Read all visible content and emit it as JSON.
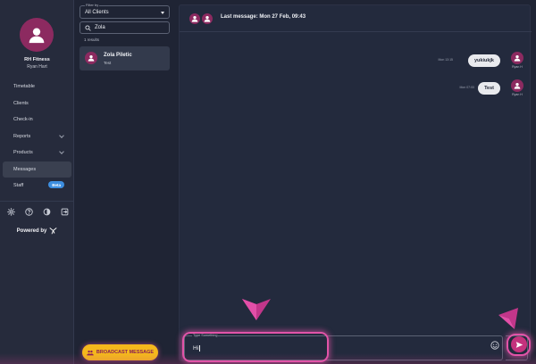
{
  "brand": {
    "name": "RH Fitness",
    "user": "Ryan Hart"
  },
  "nav": {
    "items": [
      {
        "label": "Timetable"
      },
      {
        "label": "Clients"
      },
      {
        "label": "Check-in"
      },
      {
        "label": "Reports"
      },
      {
        "label": "Products"
      },
      {
        "label": "Messages"
      },
      {
        "label": "Staff",
        "badge": "Beta"
      }
    ],
    "powered_by": "Powered by"
  },
  "clients": {
    "filter_label": "Filter by",
    "filter_value": "All Clients",
    "search_value": "Zola",
    "results": "1 results",
    "list": [
      {
        "name": "Zola Piletic",
        "preview": "Test"
      }
    ],
    "broadcast_label": "BROADCAST MESSAGE"
  },
  "chat": {
    "last_message": "Last message: Mon 27 Feb, 09:43",
    "messages": [
      {
        "time": "Mon 13:15",
        "text": "yukiukjk",
        "author": "Ryan H"
      },
      {
        "time": "Mon 07:00",
        "text": "Test",
        "author": "Ryan H"
      }
    ],
    "composer_label": "Type Something",
    "composer_value": "Hi"
  },
  "colors": {
    "accent": "#8c2a60",
    "send": "#c4327d",
    "broadcast": "#f5b81c",
    "highlight": "#e254a8",
    "beta": "#3d8ee0"
  }
}
